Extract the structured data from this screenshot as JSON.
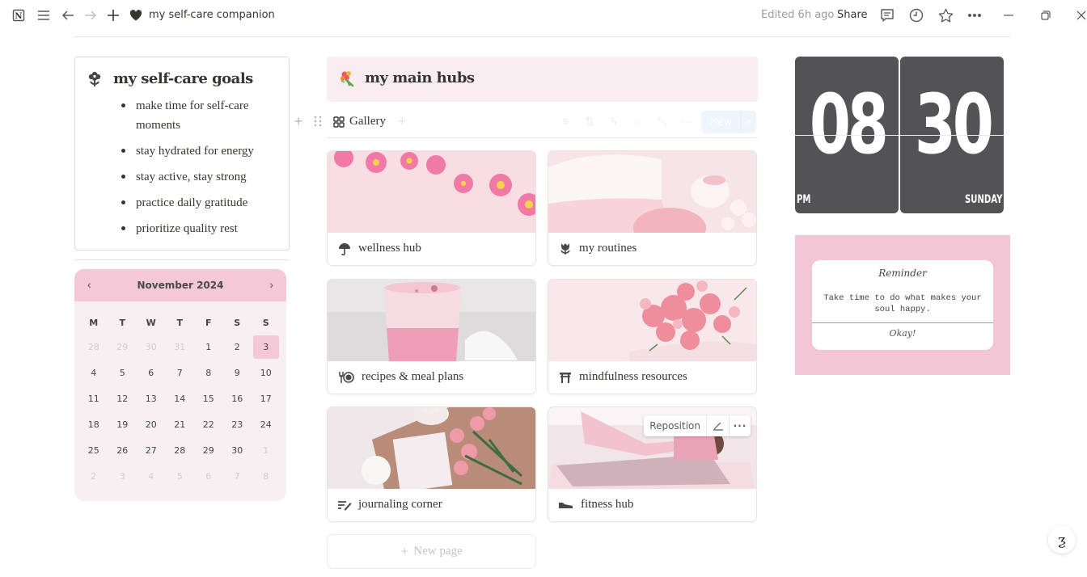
{
  "topbar": {
    "title": "my self-care companion",
    "edited": "Edited 6h ago",
    "share_label": "Share",
    "icons": [
      "notion-logo-icon",
      "menu-icon",
      "back-arrow-icon",
      "forward-arrow-icon",
      "plus-icon",
      "heart-icon",
      "comment-icon",
      "clock-history-icon",
      "star-icon",
      "more-icon",
      "minimize-icon",
      "restore-icon",
      "close-icon"
    ]
  },
  "goals": {
    "title": "my self-care goals",
    "items": [
      "make time for self-care moments",
      "stay hydrated for energy",
      "stay active, stay strong",
      "practice daily gratitude",
      "prioritize quality rest"
    ]
  },
  "calendar": {
    "month_label": "November 2024",
    "prev": "‹",
    "next": "›",
    "weekdays": [
      "M",
      "T",
      "W",
      "T",
      "F",
      "S",
      "S"
    ],
    "today": "3",
    "weeks": [
      [
        {
          "d": "28",
          "m": true
        },
        {
          "d": "29",
          "m": true
        },
        {
          "d": "30",
          "m": true
        },
        {
          "d": "31",
          "m": true
        },
        {
          "d": "1"
        },
        {
          "d": "2"
        },
        {
          "d": "3",
          "t": true
        }
      ],
      [
        {
          "d": "4"
        },
        {
          "d": "5"
        },
        {
          "d": "6"
        },
        {
          "d": "7"
        },
        {
          "d": "8"
        },
        {
          "d": "9"
        },
        {
          "d": "10"
        }
      ],
      [
        {
          "d": "11"
        },
        {
          "d": "12"
        },
        {
          "d": "13"
        },
        {
          "d": "14"
        },
        {
          "d": "15"
        },
        {
          "d": "16"
        },
        {
          "d": "17"
        }
      ],
      [
        {
          "d": "18"
        },
        {
          "d": "19"
        },
        {
          "d": "20"
        },
        {
          "d": "21"
        },
        {
          "d": "22"
        },
        {
          "d": "23"
        },
        {
          "d": "24"
        }
      ],
      [
        {
          "d": "25"
        },
        {
          "d": "26"
        },
        {
          "d": "27"
        },
        {
          "d": "28"
        },
        {
          "d": "29"
        },
        {
          "d": "30"
        },
        {
          "d": "1",
          "m": true
        }
      ],
      [
        {
          "d": "2",
          "m": true
        },
        {
          "d": "3",
          "m": true
        },
        {
          "d": "4",
          "m": true
        },
        {
          "d": "5",
          "m": true
        },
        {
          "d": "6",
          "m": true
        },
        {
          "d": "7",
          "m": true
        },
        {
          "d": "8",
          "m": true
        }
      ]
    ]
  },
  "hubs": {
    "title": "my main hubs",
    "view_label": "Gallery",
    "new_label": "New",
    "new_page_label": "New page",
    "cover_tools": {
      "reposition": "Reposition"
    },
    "cards": [
      {
        "label": "wellness hub",
        "icon": "umbrella-icon"
      },
      {
        "label": "my routines",
        "icon": "tulip-icon"
      },
      {
        "label": "recipes & meal plans",
        "icon": "fork-plate-icon"
      },
      {
        "label": "mindfulness resources",
        "icon": "torii-gate-icon"
      },
      {
        "label": "journaling corner",
        "icon": "write-note-icon"
      },
      {
        "label": "fitness hub",
        "icon": "sneaker-icon"
      }
    ]
  },
  "clock": {
    "hours": "08",
    "minutes": "30",
    "period": "PM",
    "day": "SUNDAY"
  },
  "reminder": {
    "title": "Reminder",
    "text": "Take time to do what makes your soul happy.",
    "button": "Okay!"
  },
  "colors": {
    "pink_accent": "#f5c8d7",
    "pink_light": "#f9edf1",
    "clock_bg": "#535356",
    "reminder_bg": "#f3c6d6"
  }
}
